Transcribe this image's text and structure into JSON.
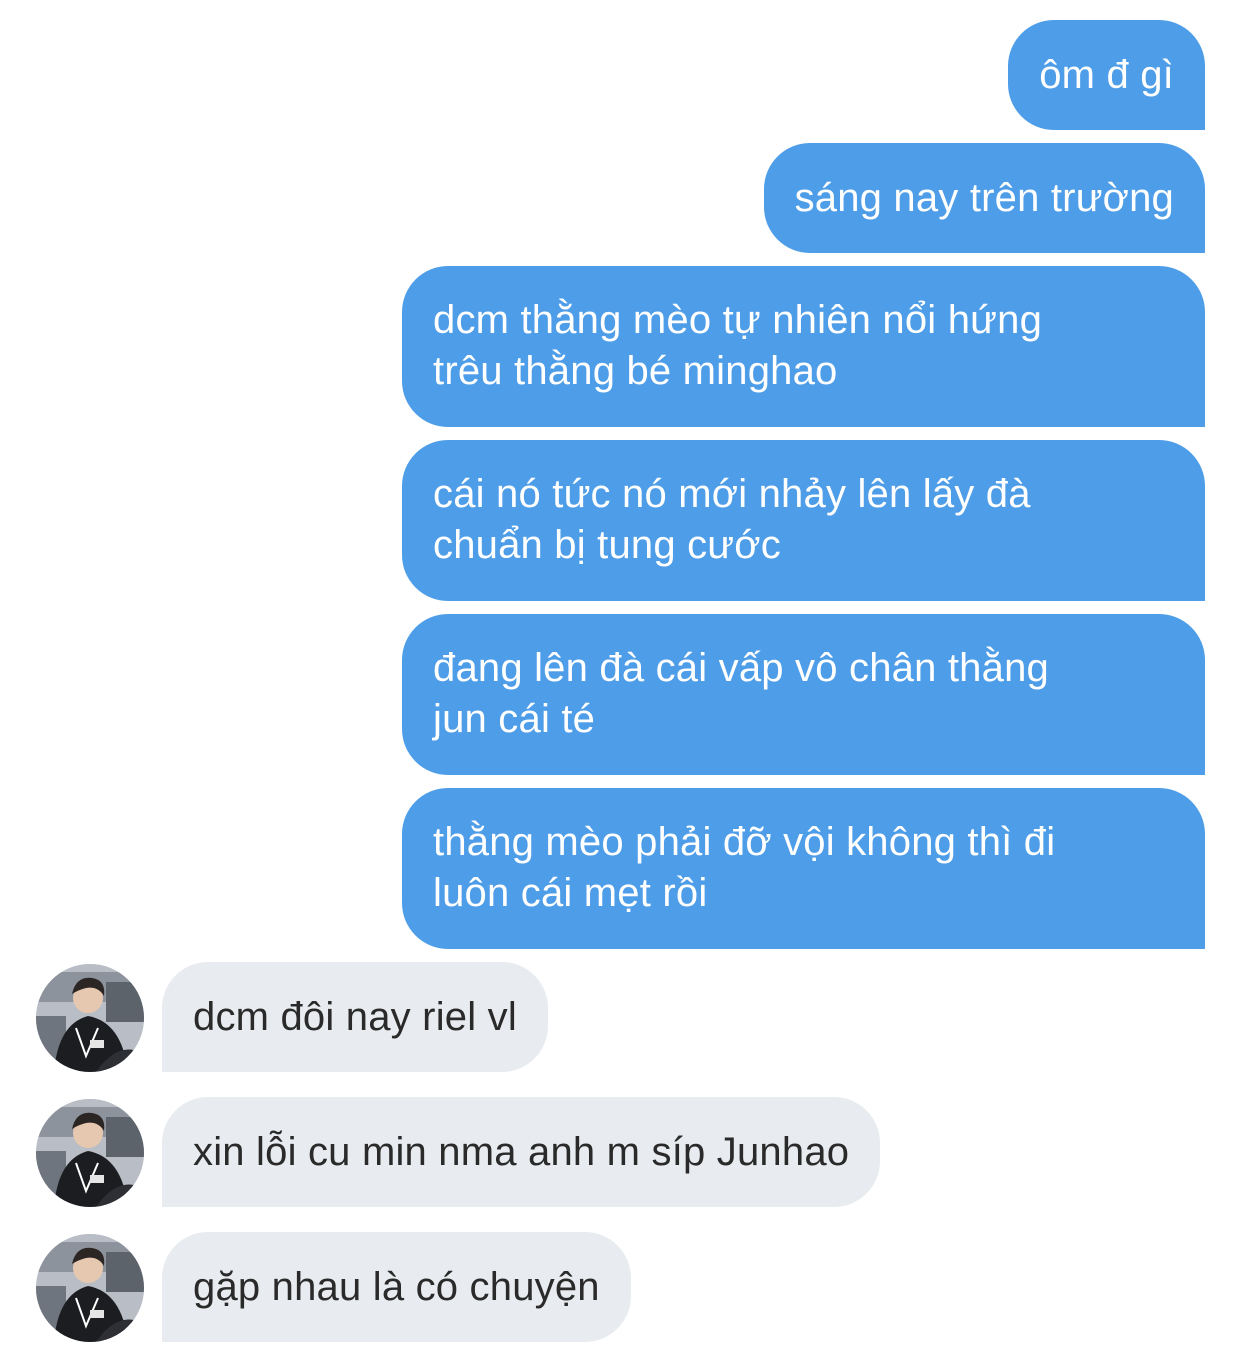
{
  "conversation": {
    "sent": [
      {
        "text": "ôm đ gì"
      },
      {
        "text": "sáng nay trên trường"
      },
      {
        "text": "dcm thằng mèo tự nhiên nổi hứng\ntrêu thằng bé minghao"
      },
      {
        "text": "cái nó tức nó mới nhảy lên lấy đà\nchuẩn bị tung cước"
      },
      {
        "text": "đang lên đà cái vấp vô chân thằng\njun cái té"
      },
      {
        "text": "thằng mèo phải đỡ vội không thì đi\nluôn cái mẹt rồi"
      }
    ],
    "received": [
      {
        "text": "dcm đôi nay riel vl"
      },
      {
        "text": "xin lỗi cu min nma anh m síp Junhao"
      },
      {
        "text": "gặp nhau là có chuyện"
      }
    ]
  },
  "colors": {
    "sent_bubble": "#4e9de8",
    "sent_text": "#ffffff",
    "received_bubble": "#e8ebef",
    "received_text": "#2a2a2a"
  }
}
